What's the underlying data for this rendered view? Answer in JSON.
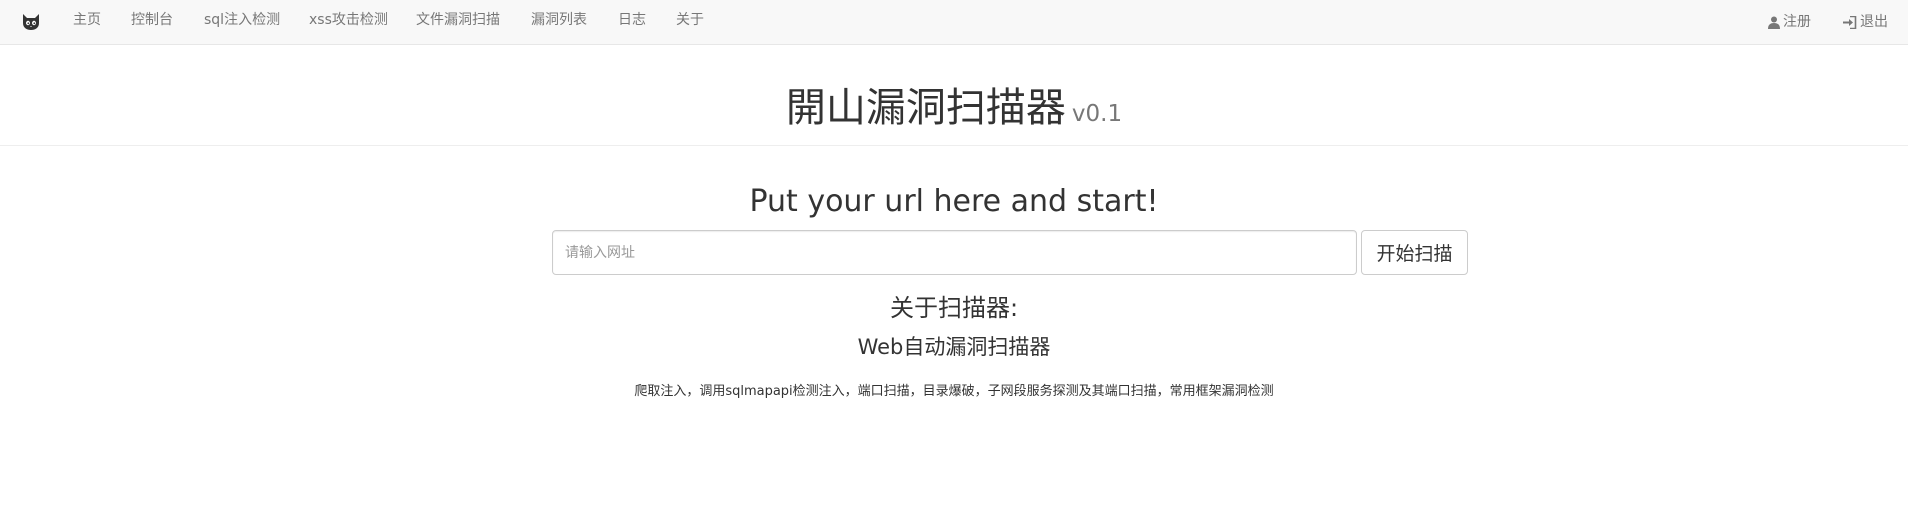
{
  "navbar": {
    "brand_icon": "cat-logo-icon",
    "items": [
      {
        "label": "主页"
      },
      {
        "label": "控制台"
      },
      {
        "label": "sql注入检测"
      },
      {
        "label": "xss攻击检测"
      },
      {
        "label": "文件漏洞扫描"
      },
      {
        "label": "漏洞列表"
      },
      {
        "label": "日志"
      },
      {
        "label": "关于"
      }
    ],
    "register": {
      "label": "注册",
      "icon": "user-icon"
    },
    "logout": {
      "label": "退出",
      "icon": "log-in-icon"
    }
  },
  "header": {
    "title": "開山漏洞扫描器",
    "version": "v0.1"
  },
  "scan": {
    "heading": "Put your url here and start!",
    "input_value": "",
    "input_placeholder": "请输入网址",
    "button_label": "开始扫描"
  },
  "about": {
    "title": "关于扫描器:",
    "subtitle": "Web自动漏洞扫描器",
    "description": "爬取注入，调用sqlmapapi检测注入，端口扫描，目录爆破，子网段服务探测及其端口扫描，常用框架漏洞检测"
  },
  "colors": {
    "navbar_bg": "#f8f8f8",
    "navbar_border": "#e7e7e7",
    "nav_text": "#777777",
    "body_text": "#333333"
  }
}
